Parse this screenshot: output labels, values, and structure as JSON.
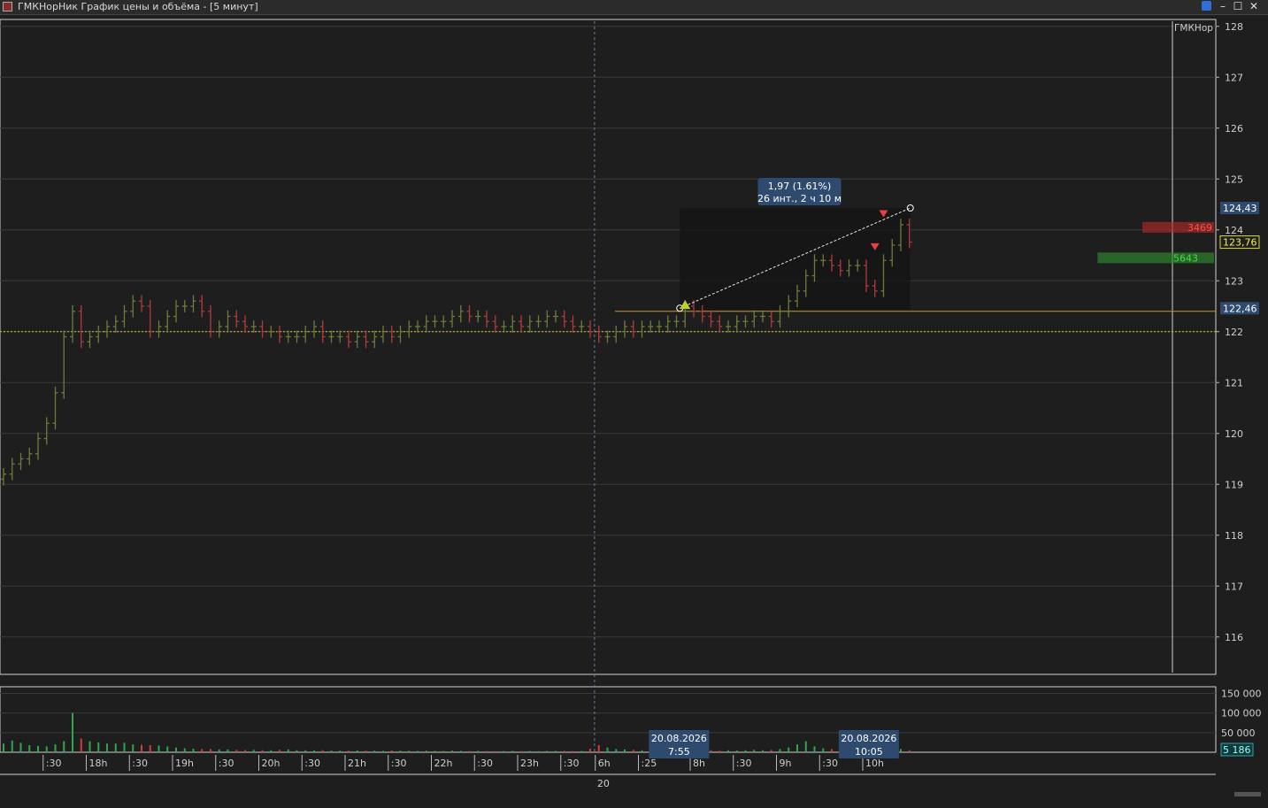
{
  "window": {
    "title": "ГМКНорНик График цены и объёма - [5 минут]",
    "minimize_glyph": "–",
    "maximize_glyph": "☐",
    "close_glyph": "✕",
    "link_icon": "link-icon"
  },
  "colors": {
    "background": "#1e1e1e",
    "grid": "#3a3a3a",
    "up": "#6b7c3a",
    "down": "#b03a3a",
    "volume_up": "#2fa64a",
    "volume_down": "#d23a3a",
    "level_line": "#c8962a",
    "dotted_level": "#d4c43a",
    "label_bg": "#2e4a6e",
    "last_price_bg": "#d8d83a"
  },
  "chart_data": {
    "type": "candlestick",
    "instrument_label": "ГМКНор",
    "price_axis": {
      "ylim": [
        115.3,
        128.1
      ],
      "ticks": [
        "128",
        "127",
        "126",
        "125",
        "124",
        "123",
        "122",
        "121",
        "120",
        "119",
        "118",
        "117",
        "116"
      ]
    },
    "price_labels": [
      {
        "value": 124.43,
        "text": "124,43",
        "style": "blue"
      },
      {
        "value": 123.76,
        "text": "123,76",
        "style": "last"
      },
      {
        "value": 122.46,
        "text": "122,46",
        "style": "blue"
      }
    ],
    "horizontal_levels": [
      {
        "value": 122.4,
        "style": "solid"
      },
      {
        "value": 122.0,
        "style": "dotted"
      }
    ],
    "measure_tool": {
      "start": {
        "bar": 79,
        "price": 122.46
      },
      "end": {
        "bar": 105,
        "price": 124.43
      },
      "line1": "1,97 (1.61%)",
      "line2": "26 инт., 2 ч 10 м"
    },
    "signals": [
      {
        "bar": 79,
        "type": "buy",
        "price": 122.55
      },
      {
        "bar": 101,
        "type": "sell",
        "price": 123.65
      },
      {
        "bar": 102,
        "type": "sell",
        "price": 124.3
      }
    ],
    "time_axis": {
      "labels": [
        ":30",
        "18h",
        ":30",
        "19h",
        ":30",
        "20h",
        ":30",
        "21h",
        ":30",
        "22h",
        ":30",
        "23h",
        ":30",
        "6h",
        ":25",
        "8h",
        ":30",
        "9h",
        ":30",
        "10h"
      ],
      "label_bars": [
        5,
        10,
        15,
        20,
        25,
        30,
        35,
        40,
        45,
        50,
        55,
        60,
        65,
        69,
        74,
        80,
        85,
        90,
        95,
        100
      ],
      "date_label": "20",
      "session_divider_bar": 68.5
    },
    "crosshair_labels": [
      {
        "bar": 78.5,
        "date": "20.08.2026",
        "time": "7:55"
      },
      {
        "bar": 100.5,
        "date": "20.08.2026",
        "time": "10:05"
      }
    ],
    "volume_axis": {
      "ylim": [
        0,
        160000
      ],
      "ticks": [
        "150 000",
        "100 000",
        "50 000"
      ],
      "last": "5 186"
    },
    "volume_profile": [
      {
        "price": 124.05,
        "value": 3469,
        "label": "3469",
        "side": "sell"
      },
      {
        "price": 123.45,
        "value": 5643,
        "label": "5643",
        "side": "buy"
      }
    ],
    "closes": [
      119.2,
      119.4,
      119.5,
      119.6,
      119.9,
      120.2,
      120.8,
      121.9,
      122.4,
      121.8,
      121.9,
      122.0,
      122.1,
      122.2,
      122.4,
      122.6,
      122.5,
      122.0,
      122.1,
      122.3,
      122.5,
      122.5,
      122.6,
      122.4,
      122.0,
      122.1,
      122.3,
      122.2,
      122.1,
      122.1,
      122.0,
      122.0,
      121.9,
      121.9,
      121.9,
      122.0,
      122.1,
      121.9,
      121.9,
      121.9,
      121.8,
      121.9,
      121.8,
      121.9,
      122.0,
      121.9,
      122.0,
      122.1,
      122.1,
      122.2,
      122.2,
      122.2,
      122.3,
      122.4,
      122.3,
      122.3,
      122.2,
      122.1,
      122.1,
      122.2,
      122.1,
      122.2,
      122.2,
      122.3,
      122.3,
      122.2,
      122.1,
      122.1,
      122.0,
      121.9,
      121.9,
      122.0,
      122.1,
      122.0,
      122.1,
      122.1,
      122.1,
      122.2,
      122.2,
      122.5,
      122.4,
      122.3,
      122.2,
      122.1,
      122.1,
      122.2,
      122.2,
      122.3,
      122.3,
      122.2,
      122.4,
      122.6,
      122.8,
      123.1,
      123.4,
      123.4,
      123.3,
      123.2,
      123.3,
      123.3,
      122.9,
      122.8,
      123.4,
      123.7,
      124.1,
      123.76
    ],
    "volumes": [
      22000,
      30000,
      24000,
      18000,
      16000,
      15000,
      20000,
      28000,
      100000,
      35000,
      28000,
      25000,
      22000,
      22000,
      24000,
      20000,
      19000,
      18000,
      17000,
      15000,
      12000,
      10000,
      9000,
      8000,
      8000,
      7000,
      7000,
      6000,
      5500,
      6000,
      5000,
      5000,
      6000,
      7000,
      5000,
      5000,
      4500,
      5000,
      4000,
      4000,
      4000,
      4500,
      4000,
      4000,
      3500,
      4500,
      4000,
      3800,
      3500,
      3800,
      3500,
      3200,
      4000,
      3500,
      3000,
      3500,
      3200,
      3000,
      3000,
      3500,
      3000,
      3200,
      3000,
      3500,
      3200,
      3400,
      3000,
      3200,
      9000,
      18000,
      12000,
      8000,
      7000,
      6000,
      5000,
      5000,
      4500,
      6000,
      5000,
      15000,
      8000,
      6000,
      5000,
      4000,
      5000,
      4500,
      5000,
      6000,
      5000,
      6000,
      8000,
      12000,
      20000,
      28000,
      15000,
      10000,
      8000,
      6000,
      9000,
      12000,
      25000,
      42000,
      20000,
      15000,
      8000,
      5186
    ]
  }
}
